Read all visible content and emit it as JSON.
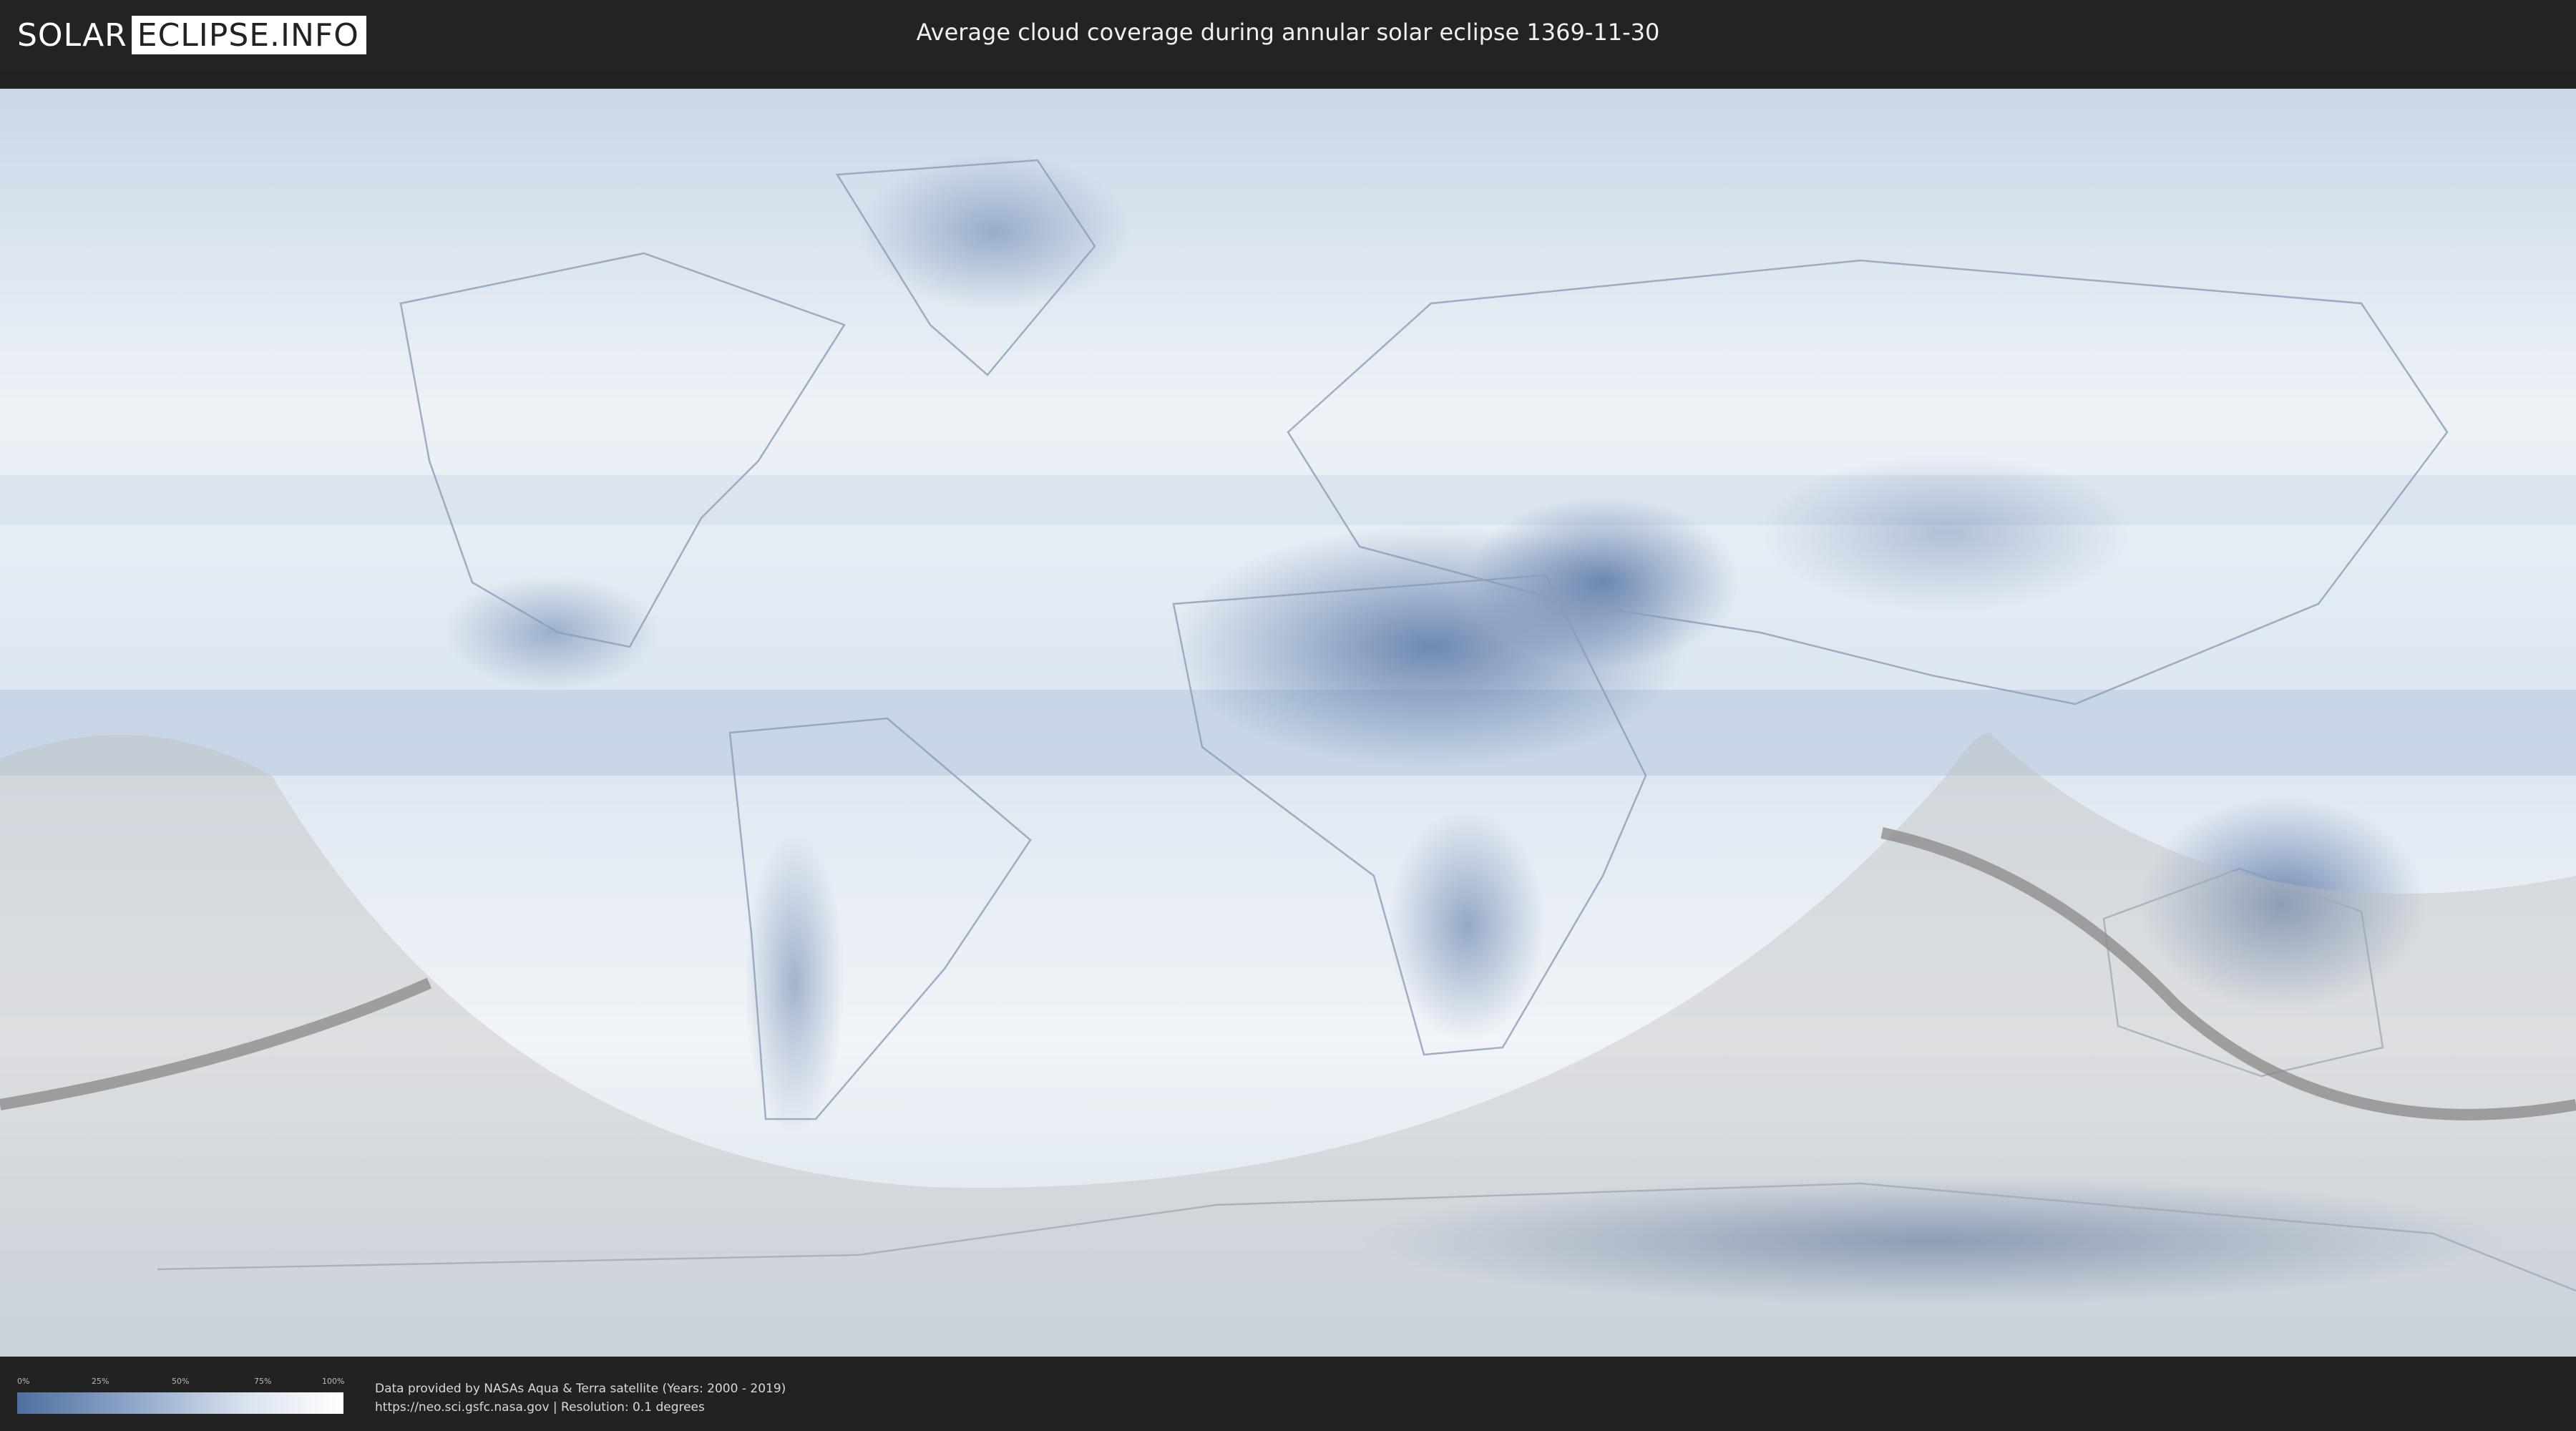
{
  "header": {
    "logo_left": "SOLAR",
    "logo_right": "ECLIPSE.INFO",
    "title": "Average cloud coverage during annular solar eclipse 1369-11-30"
  },
  "legend": {
    "ticks": [
      "0%",
      "25%",
      "50%",
      "75%",
      "100%"
    ],
    "colors": [
      "#4f6f9f",
      "#8ea6c8",
      "#d9e2ee",
      "#ffffff"
    ]
  },
  "credits": {
    "line1": "Data provided by NASAs Aqua & Terra satellite (Years: 2000 - 2019)",
    "line2": "https://neo.sci.gsfc.nasa.gov | Resolution: 0.1 degrees"
  },
  "map": {
    "background": "#dfe8f2",
    "cloud_clear_color": "#5a78a6",
    "shadow_color": "#bdbdbd",
    "eclipse_path_color": "#888888"
  }
}
